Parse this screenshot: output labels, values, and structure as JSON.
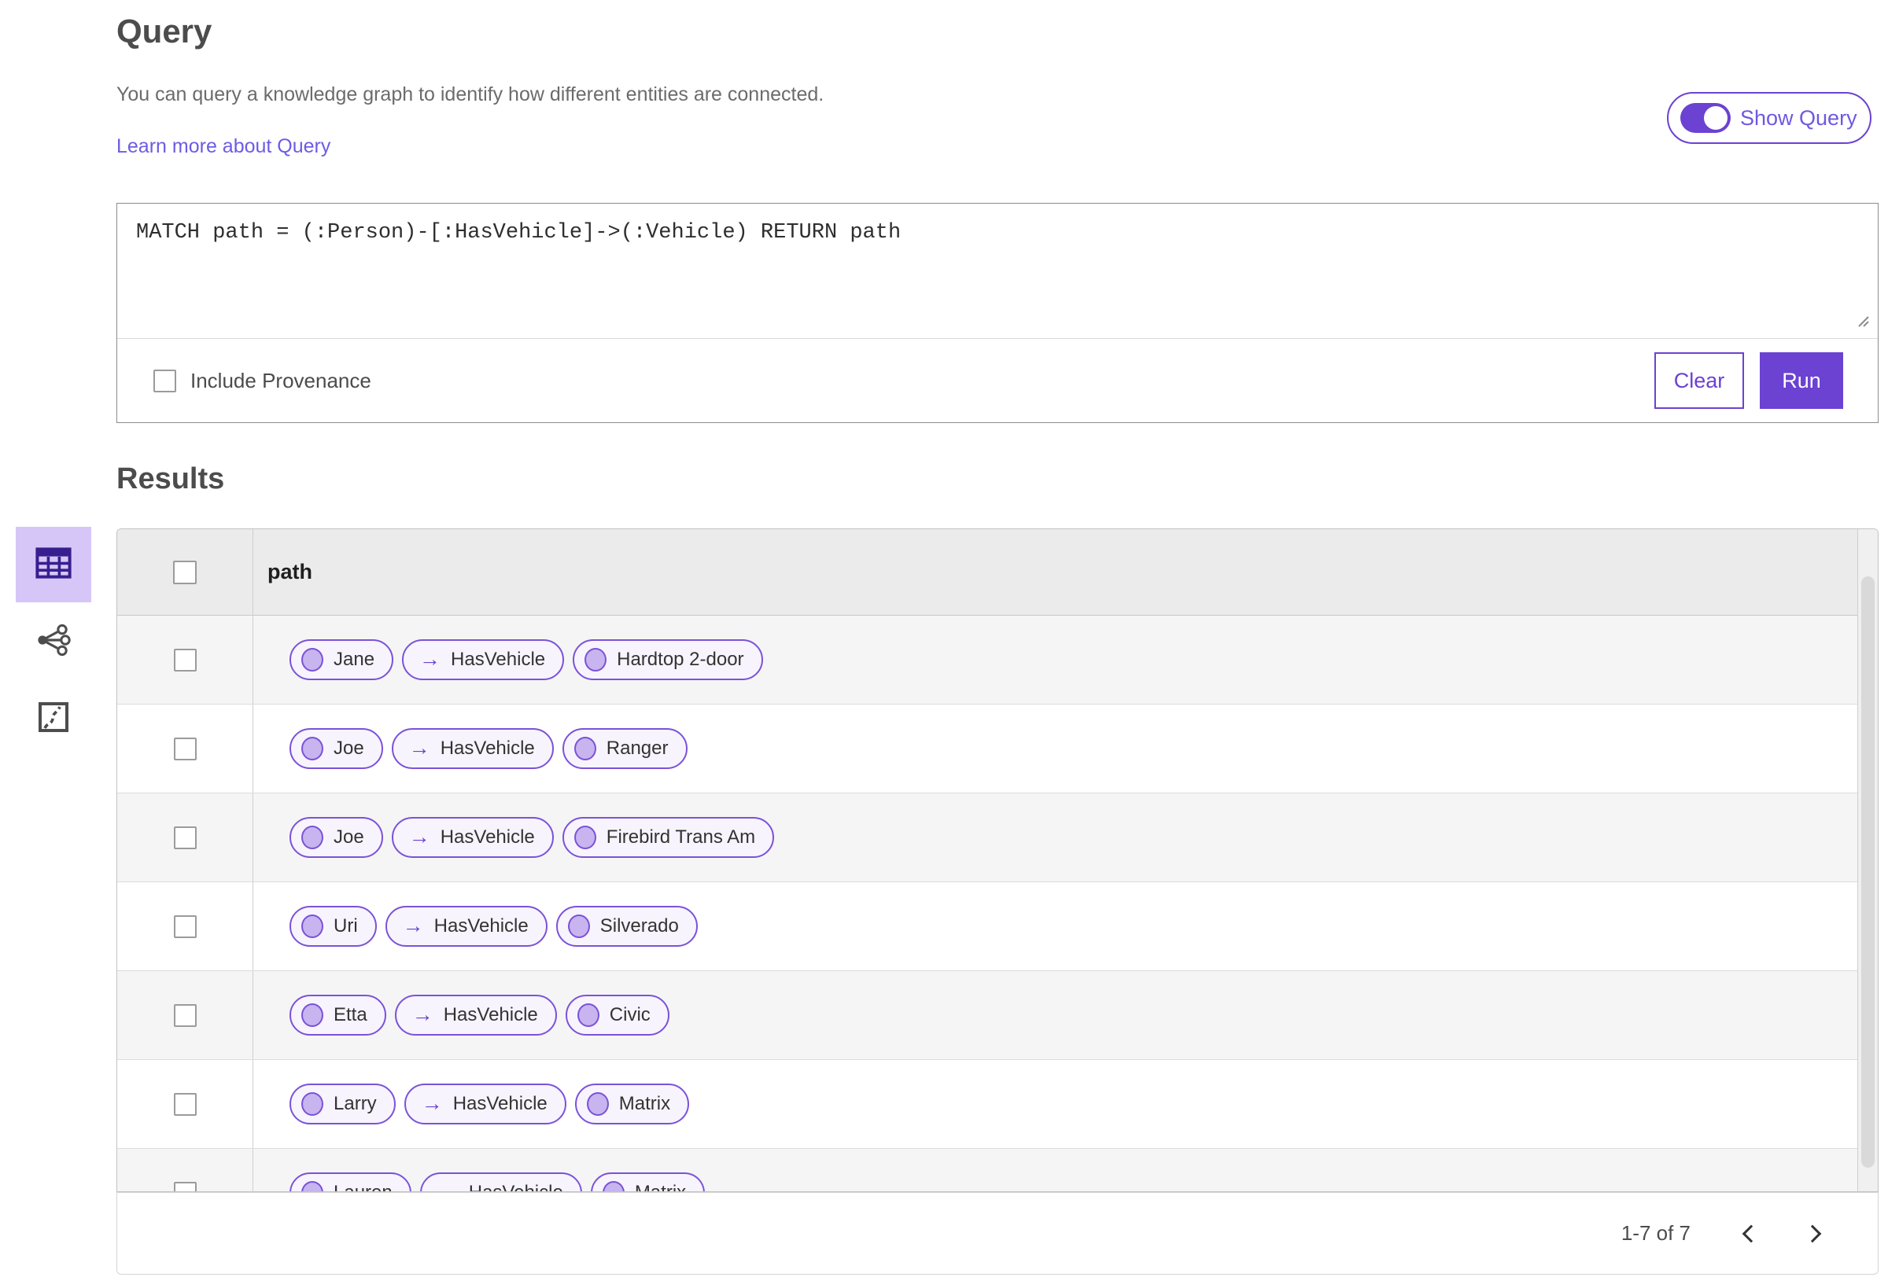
{
  "header": {
    "title": "Query",
    "description": "You can query a knowledge graph to identify how different entities are connected.",
    "learn_more_label": "Learn more about Query",
    "show_query_label": "Show Query",
    "show_query_on": true
  },
  "query_editor": {
    "query_text": "MATCH path = (:Person)-[:HasVehicle]->(:Vehicle) RETURN path",
    "include_provenance_label": "Include Provenance",
    "include_provenance_checked": false,
    "clear_label": "Clear",
    "run_label": "Run"
  },
  "results": {
    "title": "Results",
    "column_header": "path",
    "view_switcher": [
      {
        "icon": "table-view-icon",
        "selected": true
      },
      {
        "icon": "link-chart-view-icon",
        "selected": false
      },
      {
        "icon": "map-view-icon",
        "selected": false
      }
    ],
    "rows": [
      {
        "entity1": "Jane",
        "relationship": "HasVehicle",
        "entity2": "Hardtop 2-door"
      },
      {
        "entity1": "Joe",
        "relationship": "HasVehicle",
        "entity2": "Ranger"
      },
      {
        "entity1": "Joe",
        "relationship": "HasVehicle",
        "entity2": "Firebird Trans Am"
      },
      {
        "entity1": "Uri",
        "relationship": "HasVehicle",
        "entity2": "Silverado"
      },
      {
        "entity1": "Etta",
        "relationship": "HasVehicle",
        "entity2": "Civic"
      },
      {
        "entity1": "Larry",
        "relationship": "HasVehicle",
        "entity2": "Matrix"
      },
      {
        "entity1": "Lauren",
        "relationship": "HasVehicle",
        "entity2": "Matrix"
      }
    ],
    "relationship_arrow": "→",
    "pagination": {
      "range_label": "1-7 of 7"
    }
  },
  "colors": {
    "primary_purple": "#6b42d1",
    "pill_border": "#7b52d8",
    "pill_background": "#f7f4fd",
    "node_fill": "#c8b4ef",
    "selected_tile_background": "#d6c6f7",
    "link_color": "#6b5ce4",
    "table_header_background": "#ebebeb",
    "alt_row_background": "#f5f5f5"
  }
}
